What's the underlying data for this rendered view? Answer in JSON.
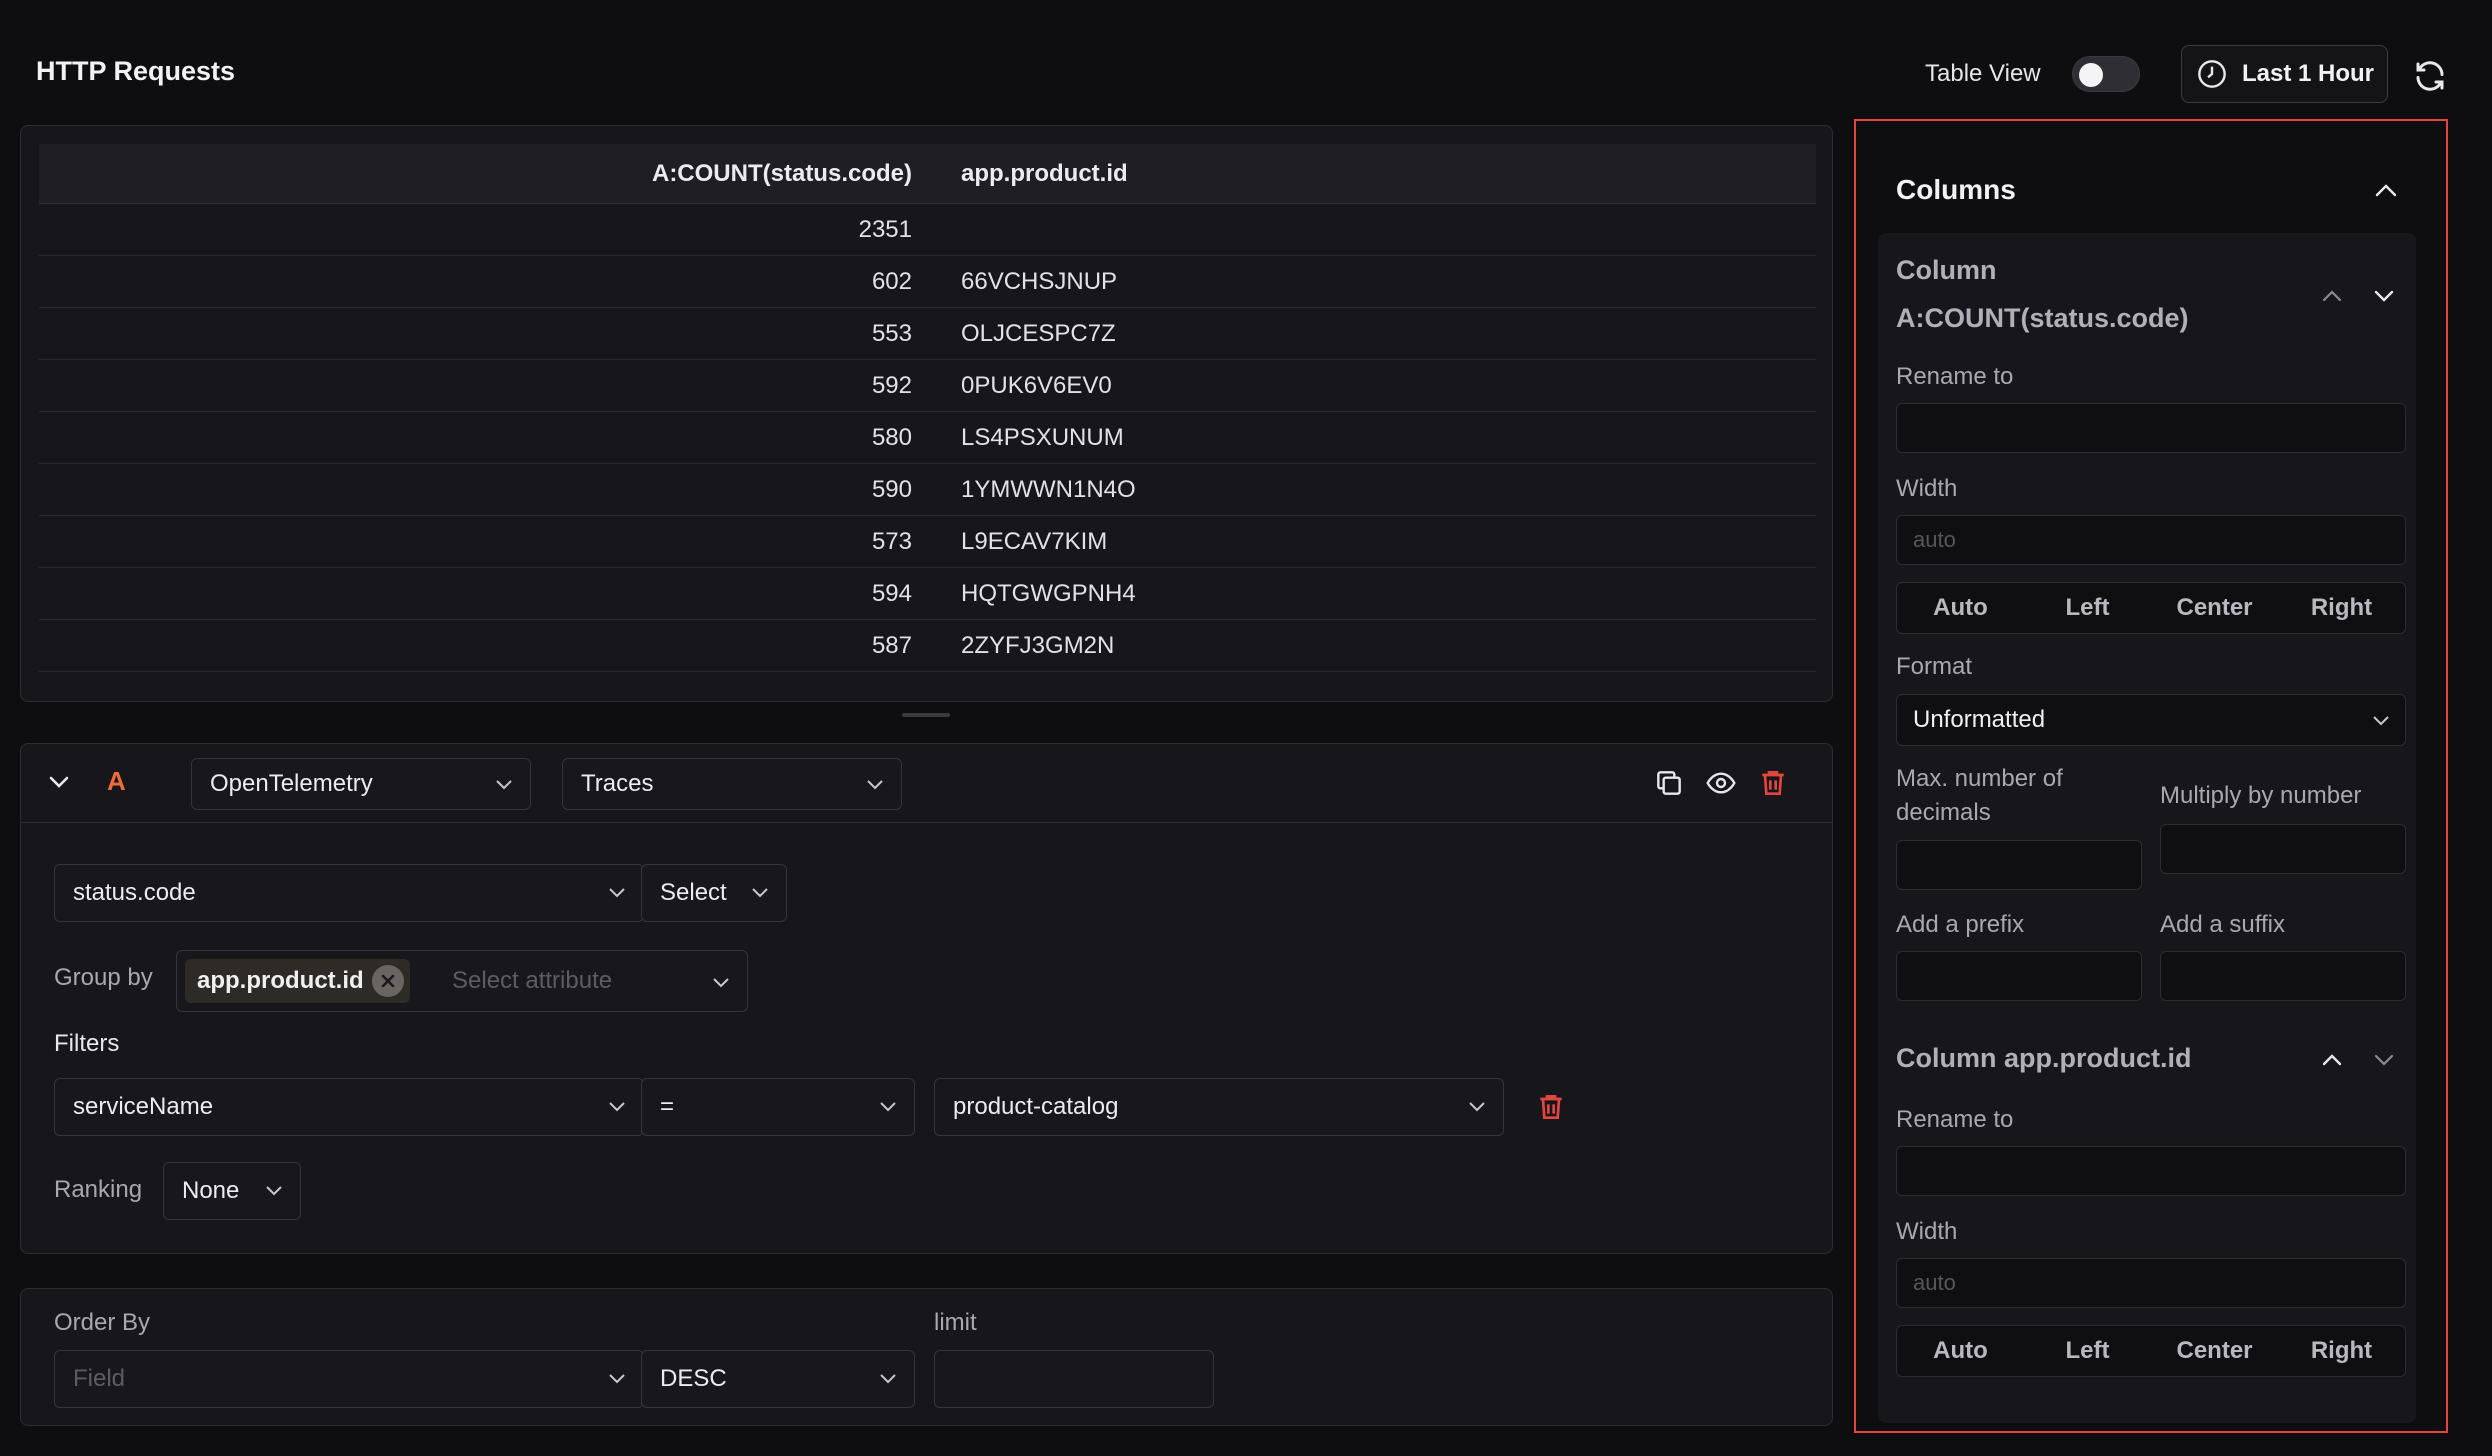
{
  "header": {
    "title": "HTTP Requests",
    "table_view_label": "Table View",
    "time_range": "Last 1 Hour"
  },
  "table": {
    "columns": [
      "A:COUNT(status.code)",
      "app.product.id"
    ],
    "rows": [
      {
        "count": "2351",
        "id": ""
      },
      {
        "count": "602",
        "id": "66VCHSJNUP"
      },
      {
        "count": "553",
        "id": "OLJCESPC7Z"
      },
      {
        "count": "592",
        "id": "0PUK6V6EV0"
      },
      {
        "count": "580",
        "id": "LS4PSXUNUM"
      },
      {
        "count": "590",
        "id": "1YMWWN1N4O"
      },
      {
        "count": "573",
        "id": "L9ECAV7KIM"
      },
      {
        "count": "594",
        "id": "HQTGWGPNH4"
      },
      {
        "count": "587",
        "id": "2ZYFJ3GM2N"
      }
    ]
  },
  "query": {
    "letter": "A",
    "source": "OpenTelemetry",
    "signal": "Traces",
    "attribute": "status.code",
    "aggregation": "Select",
    "group_by_label": "Group by",
    "group_by_chip": "app.product.id",
    "group_by_placeholder": "Select attribute",
    "filters_label": "Filters",
    "filter_field": "serviceName",
    "filter_op": "=",
    "filter_value": "product-catalog",
    "ranking_label": "Ranking",
    "ranking_value": "None"
  },
  "order": {
    "order_by_label": "Order By",
    "field_placeholder": "Field",
    "direction": "DESC",
    "limit_label": "limit"
  },
  "side": {
    "title": "Columns",
    "col1": {
      "heading_line1": "Column",
      "heading_line2": "A:COUNT(status.code)",
      "rename_label": "Rename to",
      "width_label": "Width",
      "width_placeholder": "auto",
      "align": [
        "Auto",
        "Left",
        "Center",
        "Right"
      ],
      "format_label": "Format",
      "format_value": "Unformatted",
      "decimals_label_line1": "Max. number of",
      "decimals_label_line2": "decimals",
      "multiply_label": "Multiply by number",
      "prefix_label": "Add a prefix",
      "suffix_label": "Add a suffix"
    },
    "col2": {
      "heading": "Column app.product.id",
      "rename_label": "Rename to",
      "width_label": "Width",
      "width_placeholder": "auto",
      "align": [
        "Auto",
        "Left",
        "Center",
        "Right"
      ]
    }
  },
  "colors": {
    "accent_red": "#e5453f",
    "query_letter": "#f06a3a",
    "background": "#0e0e11",
    "panel": "#17171b"
  },
  "icons": [
    "clock-icon",
    "refresh-icon",
    "chevron-down-icon",
    "chevron-up-icon",
    "copy-icon",
    "eye-icon",
    "trash-icon",
    "close-icon"
  ]
}
